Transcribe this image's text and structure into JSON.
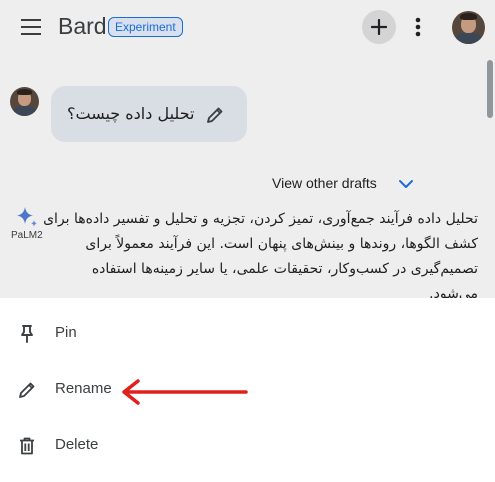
{
  "header": {
    "app_name": "Bard",
    "badge": "Experiment",
    "icons": [
      "menu-icon",
      "plus-icon",
      "more-vert-icon",
      "avatar"
    ]
  },
  "chat": {
    "prompt_text": "تحلیل داده چیست؟",
    "view_drafts_label": "View other drafts",
    "model_label": "PaLM2",
    "response_text": "تحلیل داده فرآیند جمع‌آوری، تمیز کردن، تجزیه و تحلیل و تفسیر داده‌ها برای کشف الگوها، روندها و بینش‌های پنهان است. این فرآیند معمولاً برای تصمیم‌گیری در کسب‌وکار، تحقیقات علمی، یا سایر زمینه‌ها استفاده می‌شود."
  },
  "menu": {
    "items": [
      {
        "label": "Pin",
        "icon": "pin-icon"
      },
      {
        "label": "Rename",
        "icon": "pencil-icon"
      },
      {
        "label": "Delete",
        "icon": "trash-icon"
      }
    ]
  },
  "colors": {
    "accent": "#1a73e8",
    "annotation_arrow": "#e0201b",
    "pointer_arrow": "#ffffff"
  }
}
